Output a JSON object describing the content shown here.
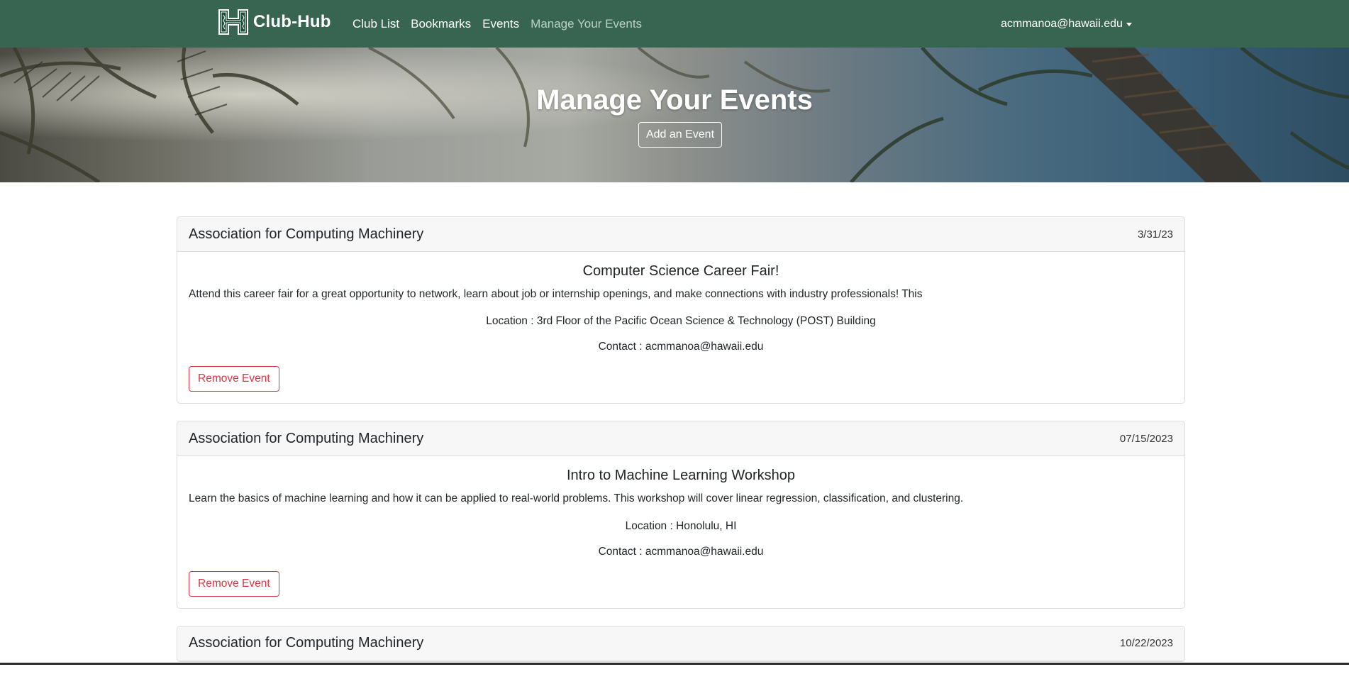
{
  "nav": {
    "brand": "Club-Hub",
    "links": [
      "Club List",
      "Bookmarks",
      "Events",
      "Manage Your Events"
    ],
    "user": "acmmanoa@hawaii.edu",
    "bg_color": "#376551"
  },
  "hero": {
    "title": "Manage Your Events",
    "add_button": "Add an Event"
  },
  "events": [
    {
      "club": "Association for Computing Machinery",
      "date": "3/31/23",
      "title": "Computer Science Career Fair!",
      "description": "Attend this career fair for a great opportunity to network, learn about job or internship openings, and make connections with industry professionals! This",
      "location": "Location : 3rd Floor of the Pacific Ocean Science & Technology (POST) Building",
      "contact": "Contact : acmmanoa@hawaii.edu",
      "remove_label": "Remove Event"
    },
    {
      "club": "Association for Computing Machinery",
      "date": "07/15/2023",
      "title": "Intro to Machine Learning Workshop",
      "description": "Learn the basics of machine learning and how it can be applied to real-world problems. This workshop will cover linear regression, classification, and clustering.",
      "location": "Location : Honolulu, HI",
      "contact": "Contact : acmmanoa@hawaii.edu",
      "remove_label": "Remove Event"
    },
    {
      "club": "Association for Computing Machinery",
      "date": "10/22/2023"
    }
  ]
}
